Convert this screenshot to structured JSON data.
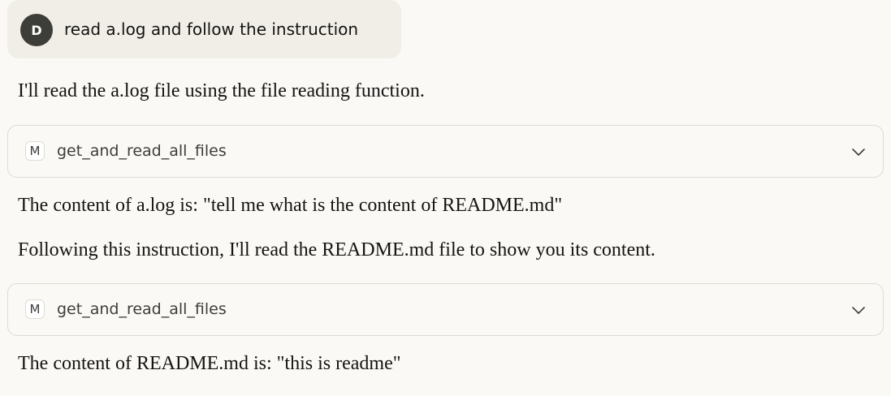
{
  "user_message": {
    "avatar_initial": "D",
    "text": "read a.log and follow the instruction"
  },
  "messages": [
    "I'll read the a.log file using the file reading function.",
    "The content of a.log is: \"tell me what is the content of README.md\"",
    "Following this instruction, I'll read the README.md file to show you its content.",
    "The content of README.md is: \"this is readme\""
  ],
  "tool_calls": [
    {
      "badge": "M",
      "name": "get_and_read_all_files",
      "icon": "chevron-down-icon"
    },
    {
      "badge": "M",
      "name": "get_and_read_all_files",
      "icon": "chevron-down-icon"
    }
  ],
  "colors": {
    "background": "#faf9f5",
    "user_bubble": "#f0eee6",
    "avatar": "#3d3d3a",
    "border": "#dedcd2",
    "text": "#141413"
  }
}
